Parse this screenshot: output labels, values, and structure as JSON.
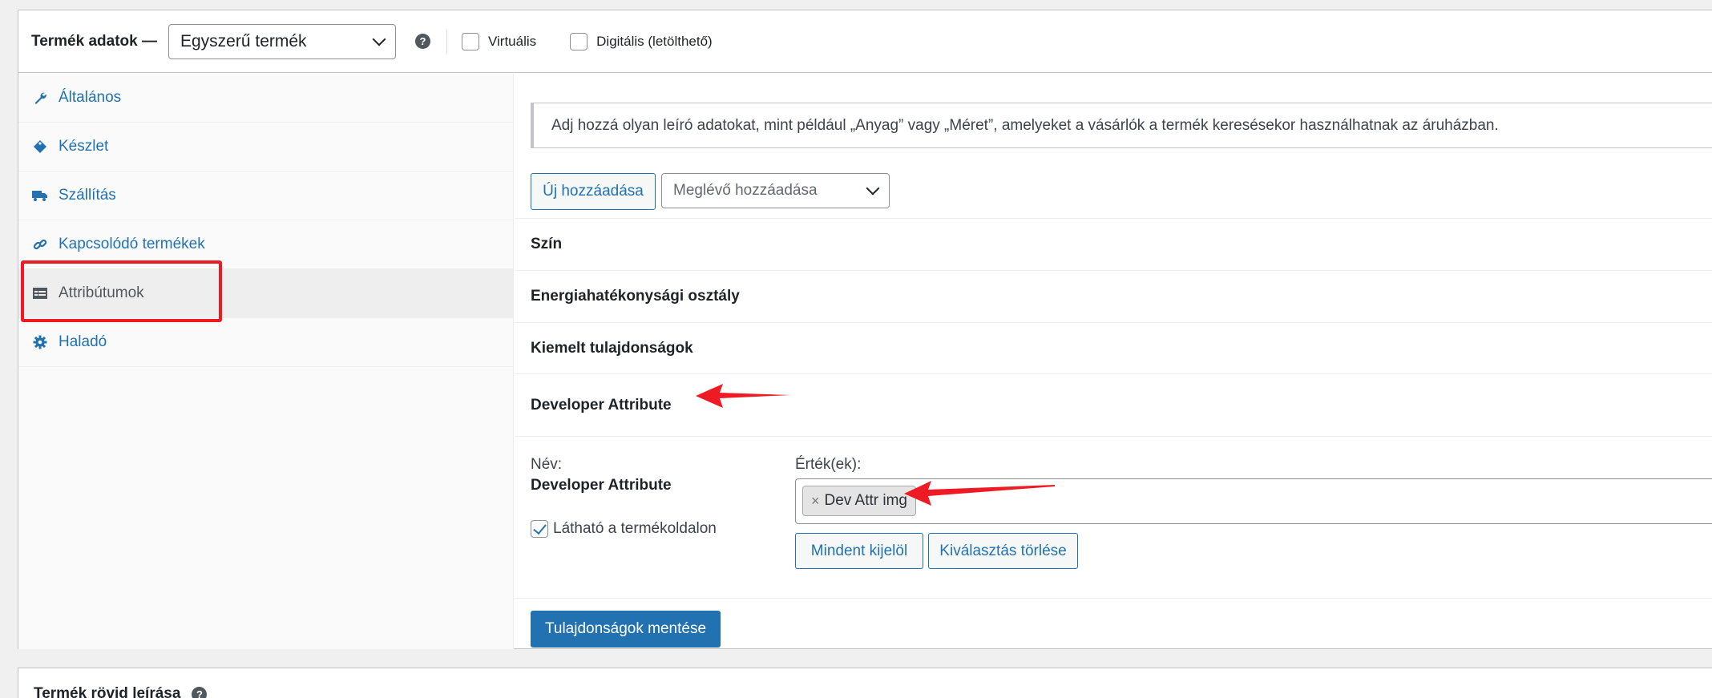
{
  "header": {
    "title": "Termék adatok —",
    "product_type": "Egyszerű termék",
    "help_icon": "question-circle-icon",
    "virtual_label": "Virtuális",
    "downloadable_label": "Digitális (letölthető)"
  },
  "tabs": [
    {
      "label": "Általános",
      "icon": "wrench-icon"
    },
    {
      "label": "Készlet",
      "icon": "tag-icon"
    },
    {
      "label": "Szállítás",
      "icon": "truck-icon"
    },
    {
      "label": "Kapcsolódó termékek",
      "icon": "link-icon"
    },
    {
      "label": "Attribútumok",
      "icon": "list-table-icon",
      "active": true
    },
    {
      "label": "Haladó",
      "icon": "gear-icon"
    }
  ],
  "attributes_panel": {
    "notice": "Adj hozzá olyan leíró adatokat, mint például „Anyag” vagy „Méret”, amelyeket a vásárlók a termék keresésekor használhatnak az áruházban.",
    "add_new_label": "Új hozzáadása",
    "existing_placeholder": "Meglévő hozzáadása",
    "attribute_rows": [
      "Szín",
      "Energiahatékonysági osztály",
      "Kiemelt tulajdonságok",
      "Developer Attribute"
    ],
    "detail": {
      "name_label": "Név:",
      "name_value": "Developer Attribute",
      "visible_label": "Látható a termékoldalon",
      "visible_checked": true,
      "values_label": "Érték(ek):",
      "values": [
        "Dev Attr img"
      ],
      "select_all_label": "Mindent kijelöl",
      "clear_label": "Kiválasztás törlése"
    },
    "save_label": "Tulajdonságok mentése"
  },
  "short_description": {
    "title": "Termék rövid leírása"
  },
  "colors": {
    "accent": "#2271b1",
    "annotation": "#ef1b24"
  }
}
